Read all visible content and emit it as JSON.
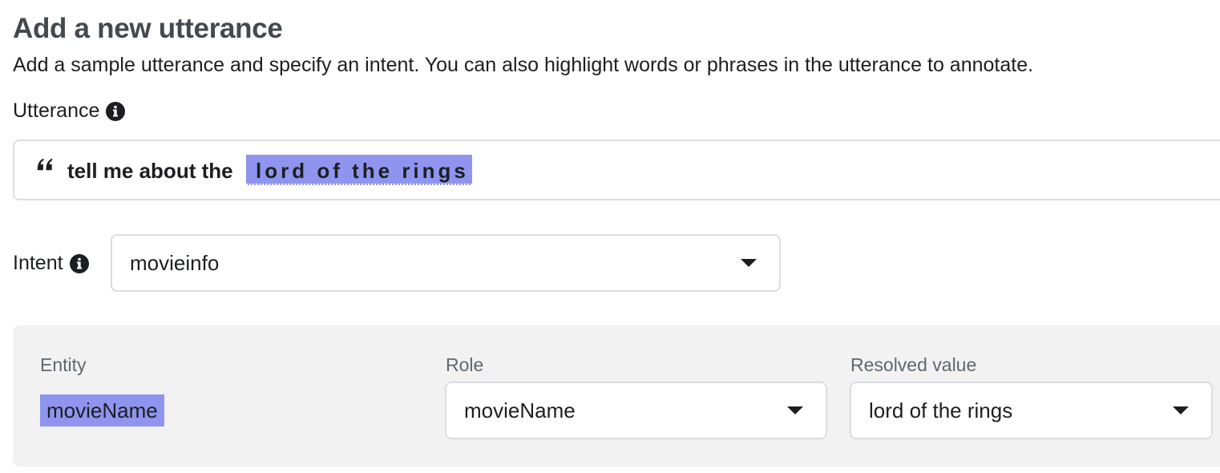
{
  "header": {
    "title": "Add a new utterance",
    "subtitle": "Add a sample utterance and specify an intent. You can also highlight words or phrases in the utterance to annotate."
  },
  "utterance": {
    "label": "Utterance",
    "text_plain": "tell me about the",
    "text_highlighted": "lord of the rings"
  },
  "intent": {
    "label": "Intent",
    "selected": "movieinfo"
  },
  "entity_panel": {
    "entity_label": "Entity",
    "role_label": "Role",
    "resolved_label": "Resolved value",
    "entity_value": "movieName",
    "role_value": "movieName",
    "resolved_value": "lord of the rings",
    "highlight_color": "#8f95ee"
  },
  "icons": [
    "info-icon",
    "quote-icon",
    "chevron-down-icon"
  ]
}
